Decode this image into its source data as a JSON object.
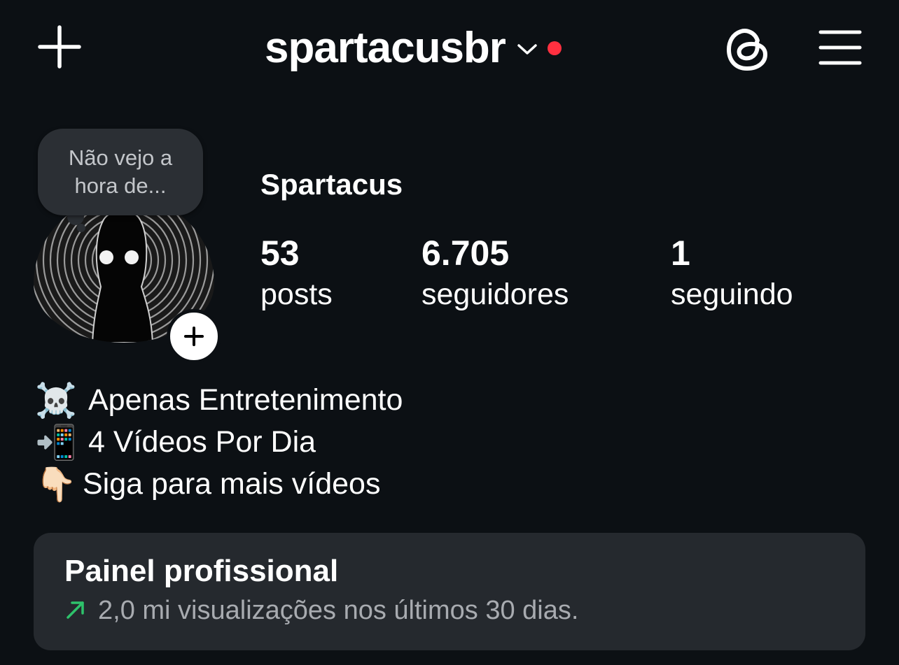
{
  "header": {
    "username": "spartacusbr",
    "icons": {
      "create": "plus-icon",
      "dropdown": "chevron-down-icon",
      "threads": "threads-icon",
      "menu": "hamburger-menu-icon"
    },
    "notification_dot_color": "#ff3040"
  },
  "profile": {
    "note": "Não vejo a hora de...",
    "display_name": "Spartacus",
    "stats": [
      {
        "value": "53",
        "label": "posts"
      },
      {
        "value": "6.705",
        "label": "seguidores"
      },
      {
        "value": "1",
        "label": "seguindo"
      }
    ]
  },
  "bio": [
    {
      "emoji": "☠️",
      "text": "Apenas Entretenimento"
    },
    {
      "emoji": "📲",
      "text": "4 Vídeos Por Dia"
    },
    {
      "emoji": "👇🏻",
      "text": "Siga para mais vídeos"
    }
  ],
  "dashboard": {
    "title": "Painel profissional",
    "subtitle": "2,0 mi visualizações nos últimos 30 dias.",
    "trend_color": "#2ec26b"
  },
  "theme": {
    "background": "#0c1014",
    "card": "#25292e",
    "muted_text": "#a8abb0"
  }
}
